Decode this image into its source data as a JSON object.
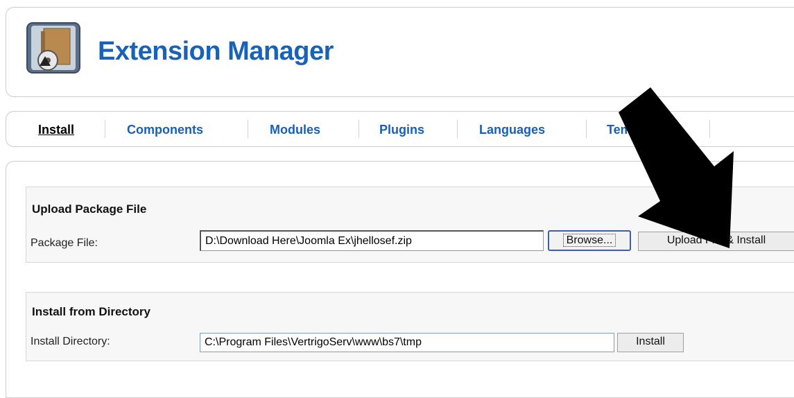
{
  "header": {
    "title": "Extension Manager",
    "logo_icon": "extension-package-icon"
  },
  "tabs": [
    {
      "label": "Install",
      "active": true
    },
    {
      "label": "Components",
      "active": false
    },
    {
      "label": "Modules",
      "active": false
    },
    {
      "label": "Plugins",
      "active": false
    },
    {
      "label": "Languages",
      "active": false
    },
    {
      "label": "Templates",
      "active": false
    }
  ],
  "upload_package": {
    "title": "Upload Package File",
    "label": "Package File:",
    "value": "D:\\Download Here\\Joomla Ex\\jhellosef.zip",
    "browse_label": "Browse...",
    "submit_label": "Upload File & Install"
  },
  "install_directory": {
    "title": "Install from Directory",
    "label": "Install Directory:",
    "value": "C:\\Program Files\\VertrigoServ\\www\\bs7\\tmp",
    "submit_label": "Install"
  },
  "colors": {
    "title": "#1863b8",
    "tab_link": "#1a5fb4",
    "arrow": "#000000"
  }
}
